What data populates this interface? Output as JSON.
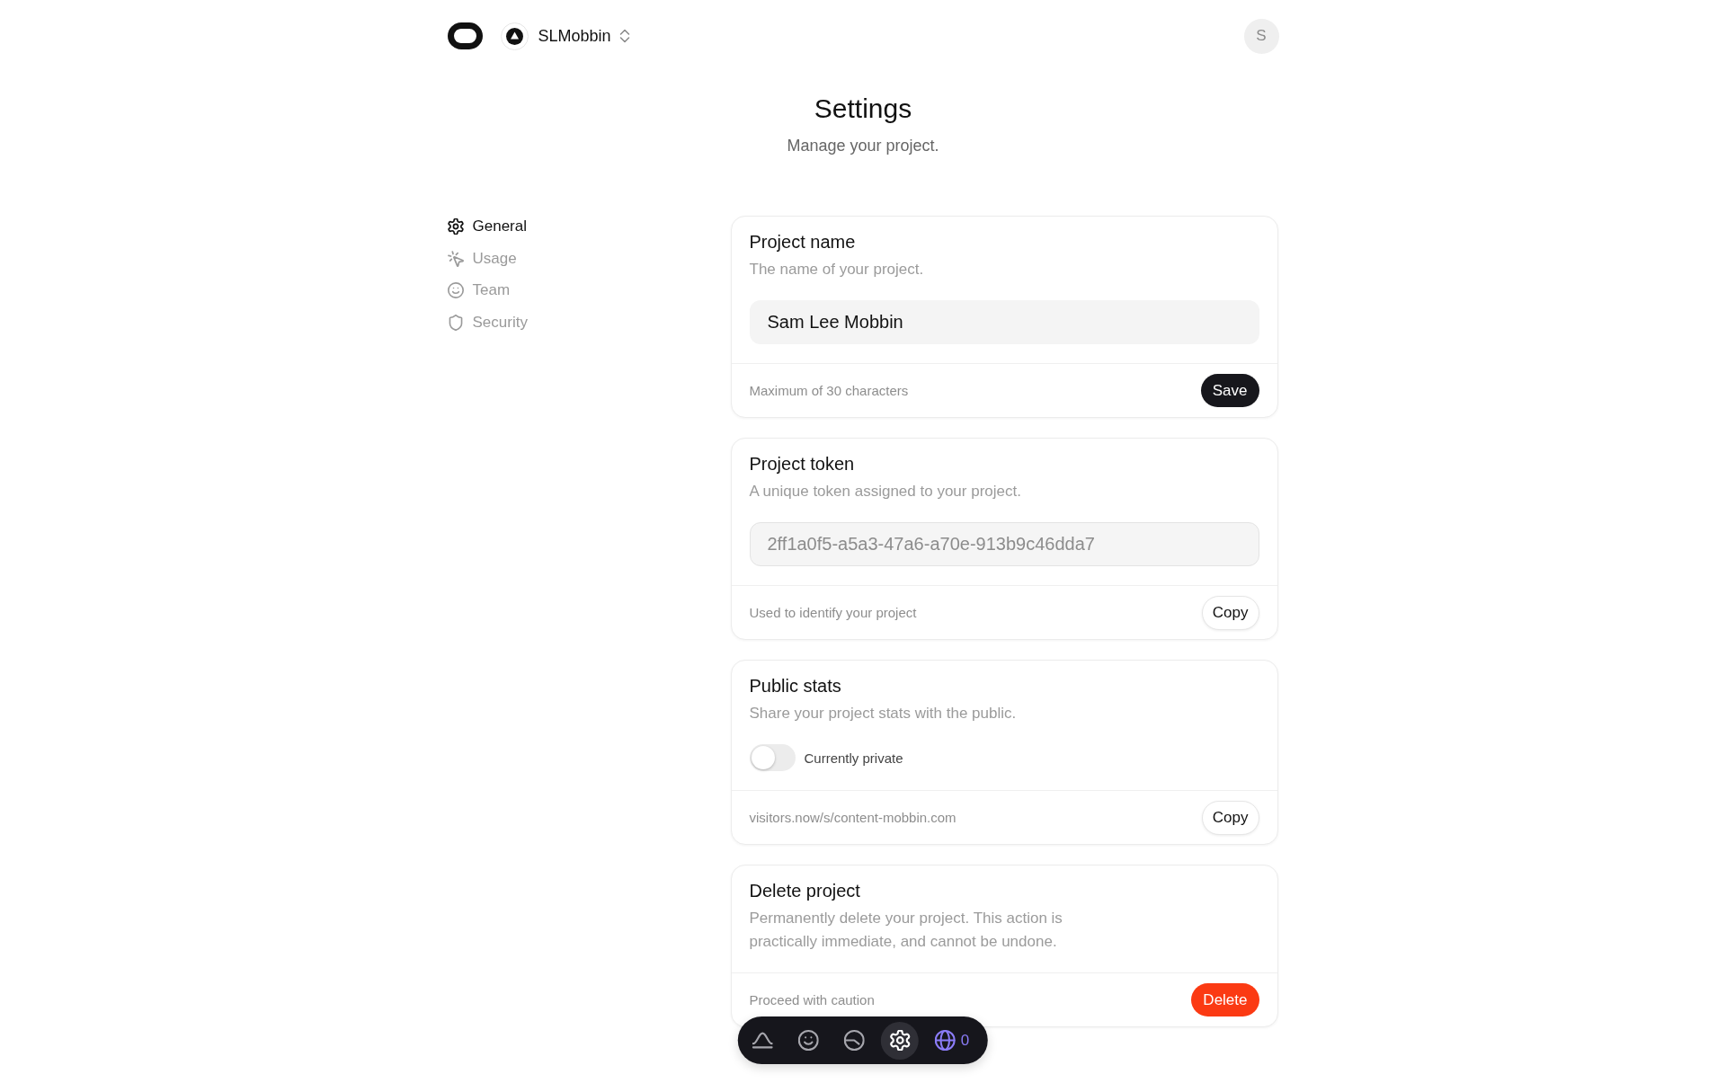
{
  "header": {
    "project_name": "SLMobbin",
    "avatar_initial": "S"
  },
  "page": {
    "title": "Settings",
    "subtitle": "Manage your project."
  },
  "sidebar": {
    "items": [
      {
        "label": "General",
        "selected": true
      },
      {
        "label": "Usage",
        "selected": false
      },
      {
        "label": "Team",
        "selected": false
      },
      {
        "label": "Security",
        "selected": false
      }
    ]
  },
  "cards": [
    {
      "kind": "input",
      "title": "Project name",
      "description": "The name of your project.",
      "field": {
        "value": "Sam Lee Mobbin",
        "disabled": false
      },
      "footer_note": "Maximum of 30 characters",
      "button": {
        "kind": "primary",
        "label": "Save"
      }
    },
    {
      "kind": "input",
      "title": "Project token",
      "description": "A unique token assigned to your project.",
      "field": {
        "value": "2ff1a0f5-a5a3-47a6-a70e-913b9c46dda7",
        "disabled": true
      },
      "footer_note": "Used to identify your project",
      "button": {
        "kind": "secondary",
        "label": "Copy"
      }
    },
    {
      "kind": "toggle",
      "title": "Public stats",
      "description": "Share your project stats with the public.",
      "toggle": {
        "on": false,
        "label": "Currently private"
      },
      "footer_note": "visitors.now/s/content-mobbin.com",
      "button": {
        "kind": "secondary",
        "label": "Copy"
      }
    },
    {
      "kind": "plain",
      "title": "Delete project",
      "description": "Permanently delete your project. This action is practically immediate, and cannot be undone.",
      "footer_note": "Proceed with caution",
      "button": {
        "kind": "danger",
        "label": "Delete"
      }
    }
  ],
  "dock": {
    "items": [
      {
        "kind": "icon",
        "selected": false
      },
      {
        "kind": "icon",
        "selected": false
      },
      {
        "kind": "icon",
        "selected": false
      },
      {
        "kind": "icon",
        "selected": true
      },
      {
        "kind": "counter",
        "selected": false,
        "count": "0"
      }
    ]
  }
}
